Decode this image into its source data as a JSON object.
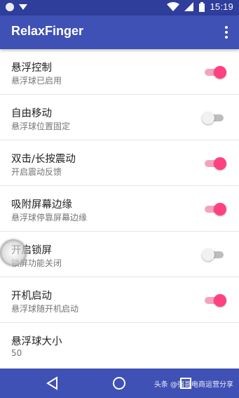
{
  "status_bar": {
    "time": "15:19",
    "icons": [
      "circle-notification-icon",
      "download-icon",
      "wifi-icon",
      "signal-icon",
      "battery-icon"
    ]
  },
  "app_bar": {
    "title": "RelaxFinger",
    "menu_icon": "overflow-menu-icon"
  },
  "settings": [
    {
      "title": "悬浮控制",
      "subtitle": "悬浮球已启用",
      "toggle": true
    },
    {
      "title": "自由移动",
      "subtitle": "悬浮球位置固定",
      "toggle": false
    },
    {
      "title": "双击/长按震动",
      "subtitle": "开启震动反馈",
      "toggle": true
    },
    {
      "title": "吸附屏幕边缘",
      "subtitle": "悬浮球停靠屏幕边缘",
      "toggle": true
    },
    {
      "title": "开启锁屏",
      "subtitle": "锁屏功能关闭",
      "toggle": false
    },
    {
      "title": "开机启动",
      "subtitle": "悬浮球随开机启动",
      "toggle": true
    },
    {
      "title": "悬浮球大小",
      "subtitle": "50"
    }
  ],
  "nav_bar": {
    "buttons": [
      "back-icon",
      "home-icon",
      "recents-icon"
    ],
    "watermark": "头条 @强哥电商运营分享"
  },
  "colors": {
    "primary": "#3f51b5",
    "status_bar": "#2f3d9b",
    "accent": "#ff4081"
  }
}
